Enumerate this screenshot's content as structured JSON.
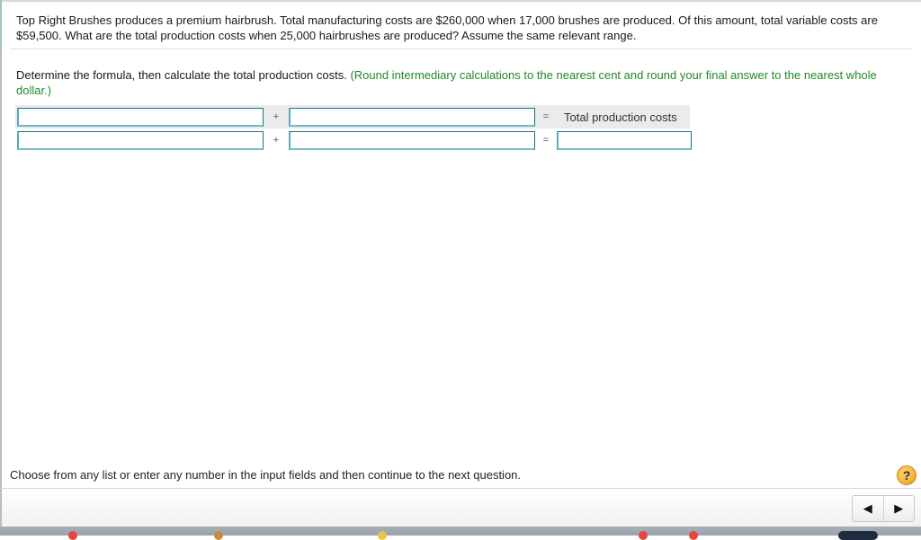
{
  "question": {
    "text": "Top Right Brushes produces a premium hairbrush. Total manufacturing costs are $260,000 when 17,000 brushes are produced. Of this amount, total variable costs are $59,500. What are the total production costs when 25,000 hairbrushes are produced? Assume the same relevant range."
  },
  "instructions": {
    "text": "Determine the formula, then calculate the total production costs.",
    "hint": "(Round intermediary calculations to the nearest cent and round your final answer to the nearest whole dollar.)"
  },
  "formula": {
    "header_row": {
      "input_1": "",
      "operator_1": "+",
      "input_2": "",
      "operator_2": "=",
      "result_label": "Total production costs"
    },
    "answer_row": {
      "input_1": "",
      "operator_1": "+",
      "input_2": "",
      "operator_2": "=",
      "result_value": ""
    }
  },
  "footer": {
    "status_text": "Choose from any list or enter any number in the input fields and then continue to the next question.",
    "help_icon": "?",
    "prev_icon": "◀",
    "next_icon": "▶"
  },
  "colors": {
    "hint_green": "#1f8a25",
    "input_border": "#157489",
    "help_orange": "#f3b33a"
  }
}
